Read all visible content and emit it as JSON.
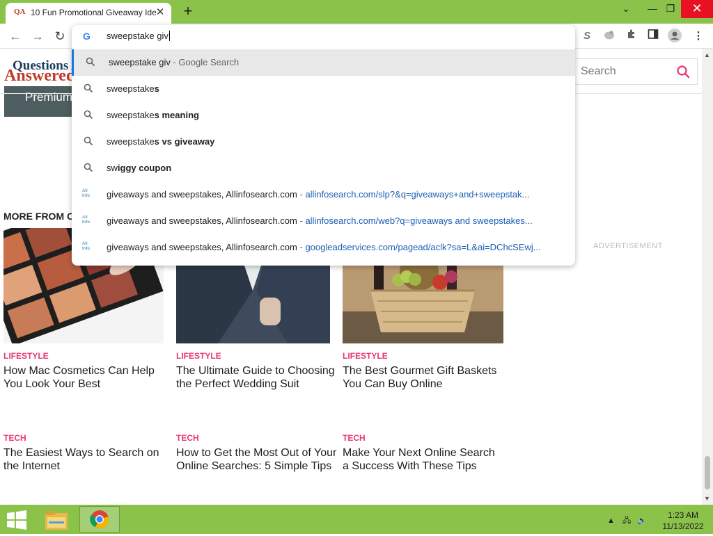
{
  "browser": {
    "tab_title": "10 Fun Promotional Giveaway Ide",
    "tab_favicon": "QA",
    "new_tab": "+",
    "tab_search_icon": "chevron-down-icon",
    "window_controls": {
      "minimize": "—",
      "restore": "❐",
      "close": "✕"
    }
  },
  "omnibox": {
    "input_value": "sweepstake giv",
    "suggestions": [
      {
        "type": "search",
        "plain": "sweepstake giv",
        "bold": "",
        "suffix": " - Google Search"
      },
      {
        "type": "search",
        "plain": "sweepstake",
        "bold": "s"
      },
      {
        "type": "search",
        "plain": "sweepstake",
        "bold": "s meaning"
      },
      {
        "type": "search",
        "plain": "sweepstake",
        "bold": "s vs giveaway"
      },
      {
        "type": "search",
        "plain": "sw",
        "bold": "iggy coupon"
      },
      {
        "type": "history",
        "line": "giveaways and sweepstakes, Allinfosearch.com",
        "url": "allinfosearch.com/slp?&q=giveaways+and+sweepstak..."
      },
      {
        "type": "history",
        "line": "giveaways and sweepstakes, Allinfosearch.com",
        "url": "allinfosearch.com/web?q=giveaways and sweepstakes..."
      },
      {
        "type": "history",
        "line": "giveaways and sweepstakes, Allinfosearch.com",
        "url": "googleadservices.com/pagead/aclk?sa=L&ai=DChcSEwj..."
      }
    ]
  },
  "site": {
    "logo_line1": "Questions",
    "logo_line2": "Answered",
    "premium_label": "Premium",
    "search_placeholder": "Search",
    "more_from": "MORE FROM C",
    "advertisement": "ADVERTISEMENT",
    "articles": [
      {
        "category": "LIFESTYLE",
        "title": "How Mac Cosmetics Can Help You Look Your Best"
      },
      {
        "category": "LIFESTYLE",
        "title": "The Ultimate Guide to Choosing the Perfect Wedding Suit"
      },
      {
        "category": "LIFESTYLE",
        "title": "The Best Gourmet Gift Baskets You Can Buy Online"
      },
      {
        "category": "TECH",
        "title": "The Easiest Ways to Search on the Internet"
      },
      {
        "category": "TECH",
        "title": "How to Get the Most Out of Your Online Searches: 5 Simple Tips"
      },
      {
        "category": "TECH",
        "title": "Make Your Next Online Search a Success With These Tips"
      }
    ]
  },
  "taskbar": {
    "time": "1:23 AM",
    "date": "11/13/2022"
  },
  "colors": {
    "frame": "#8bc34a",
    "accent": "#e8386d",
    "link": "#1a5fb4"
  }
}
